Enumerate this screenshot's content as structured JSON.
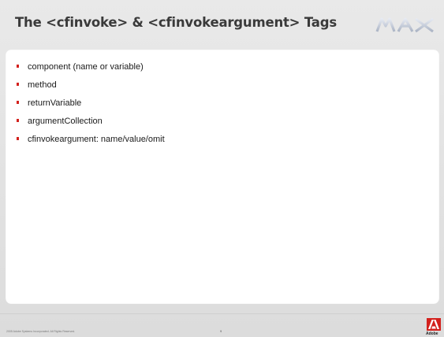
{
  "slide": {
    "title": "The <cfinvoke> & <cfinvokeargument> Tags",
    "bullets": [
      "component (name or variable)",
      "method",
      "returnVariable",
      "argumentCollection",
      "cfinvokeargument: name/value/omit"
    ],
    "page_number": "9",
    "copyright": "2005 Adobe Systems Incorporated.  All Rights Reserved.",
    "brand_logo": "MAX",
    "company_logo": "Adobe"
  },
  "colors": {
    "bullet": "#d3211d",
    "title": "#3a3a3a",
    "adobe_red": "#d3211d"
  },
  "icons": [
    "max-logo-icon",
    "adobe-logo-icon"
  ]
}
